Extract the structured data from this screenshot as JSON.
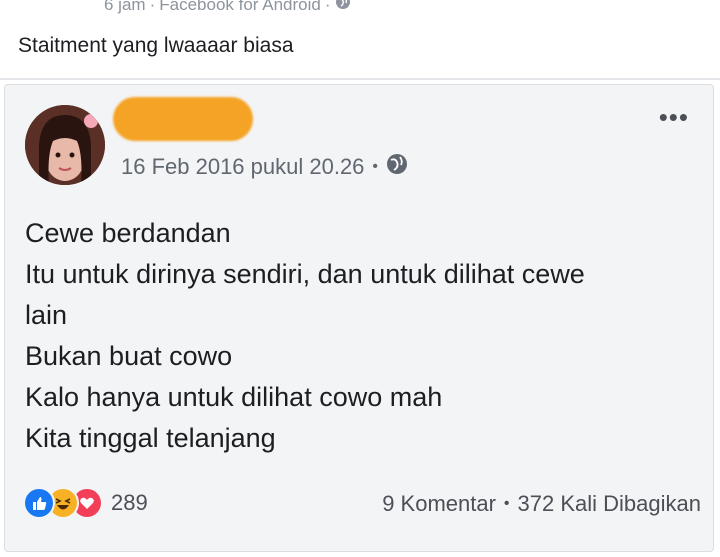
{
  "outer_post": {
    "time": "6 jam",
    "separator": "·",
    "source": "Facebook for Android",
    "caption": "Staitment yang lwaaaar biasa",
    "privacy_icon": "globe-icon"
  },
  "shared_post": {
    "date": "16 Feb 2016 pukul 20.26",
    "separator": "•",
    "privacy_icon": "globe-icon",
    "more_label": "•••",
    "body_lines": [
      "Cewe berdandan",
      "Itu untuk dirinya sendiri, dan untuk dilihat cewe",
      "lain",
      "Bukan buat cowo",
      "Kalo hanya untuk dilihat cowo mah",
      "Kita tinggal telanjang"
    ],
    "reaction_icons": [
      "like-icon",
      "haha-icon",
      "love-icon"
    ],
    "reaction_count": "289",
    "comments": "9 Komentar",
    "stats_separator": "•",
    "shares": "372 Kali Dibagikan"
  },
  "colors": {
    "like": "#1877f2",
    "haha": "#f7b125",
    "love": "#f33e58",
    "redaction": "#f4a324"
  }
}
